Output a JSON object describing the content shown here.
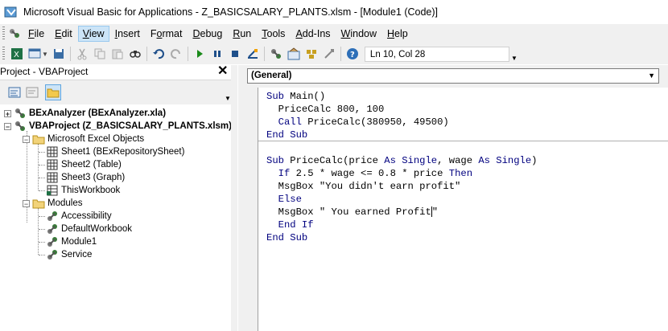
{
  "window": {
    "title": "Microsoft Visual Basic for Applications - Z_BASICSALARY_PLANTS.xlsm - [Module1 (Code)]"
  },
  "menubar": {
    "items": [
      {
        "pre": "",
        "u": "F",
        "post": "ile"
      },
      {
        "pre": "",
        "u": "E",
        "post": "dit"
      },
      {
        "pre": "",
        "u": "V",
        "post": "iew"
      },
      {
        "pre": "",
        "u": "I",
        "post": "nsert"
      },
      {
        "pre": "F",
        "u": "o",
        "post": "rmat"
      },
      {
        "pre": "",
        "u": "D",
        "post": "ebug"
      },
      {
        "pre": "",
        "u": "R",
        "post": "un"
      },
      {
        "pre": "",
        "u": "T",
        "post": "ools"
      },
      {
        "pre": "",
        "u": "A",
        "post": "dd-Ins"
      },
      {
        "pre": "",
        "u": "W",
        "post": "indow"
      },
      {
        "pre": "",
        "u": "H",
        "post": "elp"
      }
    ],
    "active_index": 2
  },
  "toolbar": {
    "position_label": "Ln 10, Col 28"
  },
  "project_explorer": {
    "title": "Project - VBAProject",
    "close": "✕",
    "tree": {
      "bex": "BExAnalyzer (BExAnalyzer.xla)",
      "vbaproject": "VBAProject (Z_BASICSALARY_PLANTS.xlsm)",
      "excel_objects": "Microsoft Excel Objects",
      "sheet1": "Sheet1 (BExRepositorySheet)",
      "sheet2": "Sheet2 (Table)",
      "sheet3": "Sheet3 (Graph)",
      "thisworkbook": "ThisWorkbook",
      "modules": "Modules",
      "accessibility": "Accessibility",
      "defaultworkbook": "DefaultWorkbook",
      "module1": "Module1",
      "service": "Service"
    }
  },
  "code_window": {
    "object_combo": "(General)",
    "lines": {
      "l1_kw": "Sub",
      "l1_rest": " Main()",
      "l2": "  PriceCalc 800, 100",
      "l3_kw": "  Call",
      "l3_rest": " PriceCalc(380950, 49500)",
      "l4_kw": "End Sub",
      "l5_kw": "Sub",
      "l5_a": " PriceCalc(price ",
      "l5_as1": "As Single",
      "l5_b": ", wage ",
      "l5_as2": "As Single",
      "l5_c": ")",
      "l6_if": "  If",
      "l6_mid": " 2.5 * wage <= 0.8 * price ",
      "l6_then": "Then",
      "l7": "  MsgBox \"You didn't earn profit\"",
      "l8_kw": "  Else",
      "l9": "  MsgBox \" You earned Profit",
      "l9_end": "\"",
      "l10_kw": "  End If",
      "l11_kw": "End Sub"
    }
  },
  "colors": {
    "keyword": "#00007f",
    "selected_menu": "#cce4f7",
    "pane_bg": "#f0f0f0"
  }
}
